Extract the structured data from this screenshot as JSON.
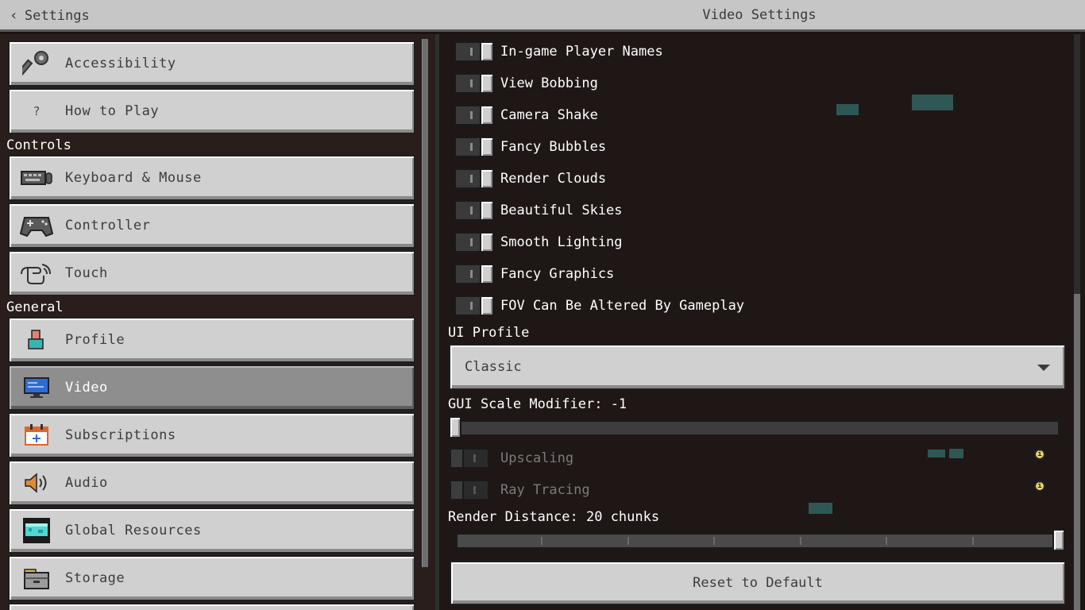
{
  "header": {
    "back_label": "Settings",
    "title": "Video Settings"
  },
  "sidebar": {
    "sections": {
      "controls": "Controls",
      "general": "General"
    },
    "items": [
      {
        "label": "Accessibility",
        "icon": "key-icon"
      },
      {
        "label": "How to Play",
        "icon": "question-icon"
      },
      {
        "label": "Keyboard & Mouse",
        "icon": "keyboard-icon"
      },
      {
        "label": "Controller",
        "icon": "gamepad-icon"
      },
      {
        "label": "Touch",
        "icon": "hand-icon"
      },
      {
        "label": "Profile",
        "icon": "profile-icon"
      },
      {
        "label": "Video",
        "icon": "monitor-icon",
        "active": true
      },
      {
        "label": "Subscriptions",
        "icon": "calendar-plus-icon"
      },
      {
        "label": "Audio",
        "icon": "speaker-icon"
      },
      {
        "label": "Global Resources",
        "icon": "resource-pack-icon"
      },
      {
        "label": "Storage",
        "icon": "storage-box-icon"
      }
    ]
  },
  "video": {
    "toggles": [
      {
        "label": "In-game Player Names",
        "on": true
      },
      {
        "label": "View Bobbing",
        "on": true
      },
      {
        "label": "Camera Shake",
        "on": true
      },
      {
        "label": "Fancy Bubbles",
        "on": true
      },
      {
        "label": "Render Clouds",
        "on": true
      },
      {
        "label": "Beautiful Skies",
        "on": true
      },
      {
        "label": "Smooth Lighting",
        "on": true
      },
      {
        "label": "Fancy Graphics",
        "on": true
      },
      {
        "label": "FOV Can Be Altered By Gameplay",
        "on": true
      }
    ],
    "ui_profile": {
      "label": "UI Profile",
      "value": "Classic"
    },
    "gui_scale": {
      "label": "GUI Scale Modifier: -1",
      "value": -1
    },
    "disabled_toggles": [
      {
        "label": "Upscaling",
        "on": false
      },
      {
        "label": "Ray Tracing",
        "on": false
      }
    ],
    "render_distance": {
      "label": "Render Distance: 20 chunks",
      "value": 20
    },
    "reset_label": "Reset to Default"
  },
  "colors": {
    "panel": "#d0d0d0",
    "active_panel": "#8e8e8e",
    "background": "#1f1716",
    "info": "#e6d36a"
  }
}
